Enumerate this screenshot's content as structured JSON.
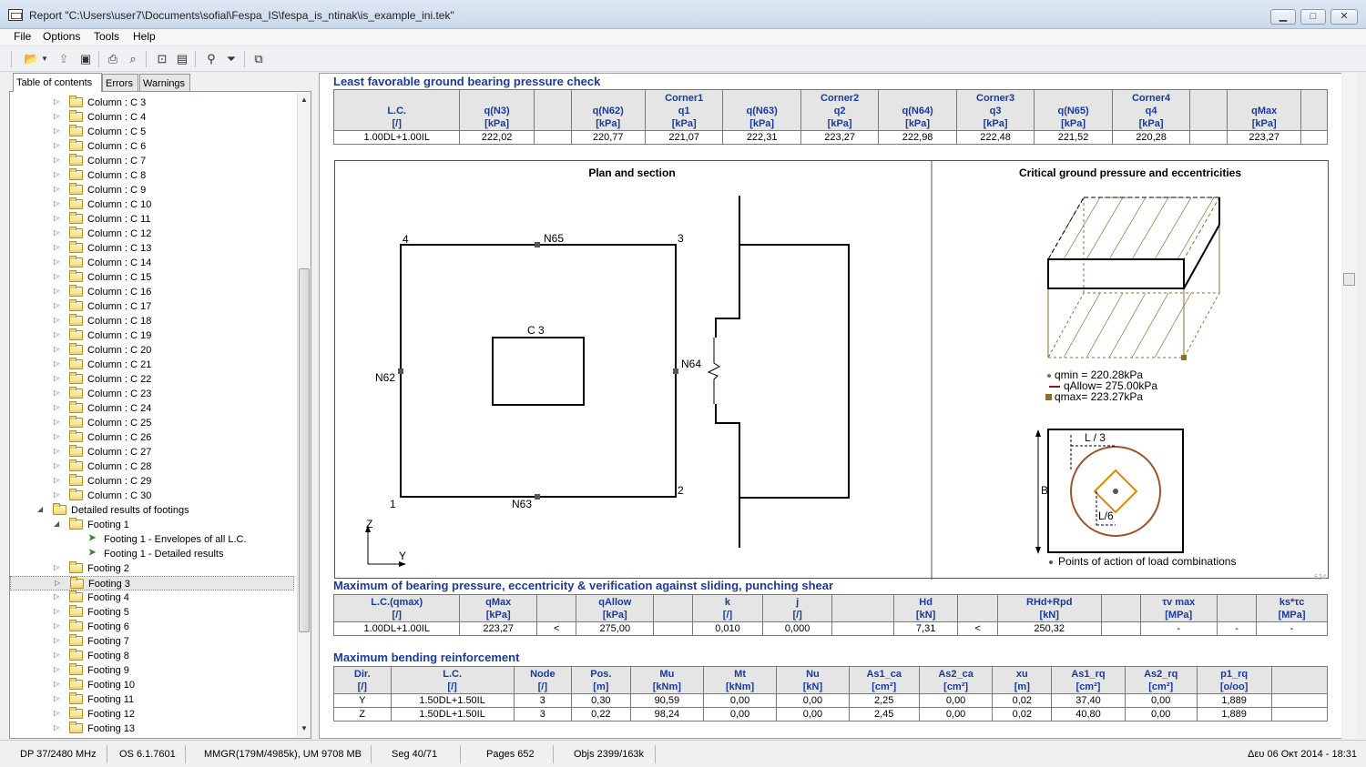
{
  "window": {
    "title": "Report \"C:\\Users\\user7\\Documents\\sofial\\Fespa_IS\\fespa_is_ntinak\\is_example_ini.tek\"",
    "minimize": "▁",
    "maximize": "□",
    "close": "✕"
  },
  "menu": [
    "File",
    "Options",
    "Tools",
    "Help"
  ],
  "tabs": [
    "Table of contents",
    "Errors",
    "Warnings"
  ],
  "tree": [
    {
      "label": "Column : C 3",
      "level": 2,
      "kind": "folder"
    },
    {
      "label": "Column : C 4",
      "level": 2,
      "kind": "folder"
    },
    {
      "label": "Column : C 5",
      "level": 2,
      "kind": "folder"
    },
    {
      "label": "Column : C 6",
      "level": 2,
      "kind": "folder"
    },
    {
      "label": "Column : C 7",
      "level": 2,
      "kind": "folder"
    },
    {
      "label": "Column : C 8",
      "level": 2,
      "kind": "folder"
    },
    {
      "label": "Column : C 9",
      "level": 2,
      "kind": "folder"
    },
    {
      "label": "Column : C 10",
      "level": 2,
      "kind": "folder"
    },
    {
      "label": "Column : C 11",
      "level": 2,
      "kind": "folder"
    },
    {
      "label": "Column : C 12",
      "level": 2,
      "kind": "folder"
    },
    {
      "label": "Column : C 13",
      "level": 2,
      "kind": "folder"
    },
    {
      "label": "Column : C 14",
      "level": 2,
      "kind": "folder"
    },
    {
      "label": "Column : C 15",
      "level": 2,
      "kind": "folder"
    },
    {
      "label": "Column : C 16",
      "level": 2,
      "kind": "folder"
    },
    {
      "label": "Column : C 17",
      "level": 2,
      "kind": "folder"
    },
    {
      "label": "Column : C 18",
      "level": 2,
      "kind": "folder"
    },
    {
      "label": "Column : C 19",
      "level": 2,
      "kind": "folder"
    },
    {
      "label": "Column : C 20",
      "level": 2,
      "kind": "folder"
    },
    {
      "label": "Column : C 21",
      "level": 2,
      "kind": "folder"
    },
    {
      "label": "Column : C 22",
      "level": 2,
      "kind": "folder"
    },
    {
      "label": "Column : C 23",
      "level": 2,
      "kind": "folder"
    },
    {
      "label": "Column : C 24",
      "level": 2,
      "kind": "folder"
    },
    {
      "label": "Column : C 25",
      "level": 2,
      "kind": "folder"
    },
    {
      "label": "Column : C 26",
      "level": 2,
      "kind": "folder"
    },
    {
      "label": "Column : C 27",
      "level": 2,
      "kind": "folder"
    },
    {
      "label": "Column : C 28",
      "level": 2,
      "kind": "folder"
    },
    {
      "label": "Column : C 29",
      "level": 2,
      "kind": "folder"
    },
    {
      "label": "Column : C 30",
      "level": 2,
      "kind": "folder"
    },
    {
      "label": "Detailed results of footings",
      "level": 1,
      "kind": "folder",
      "expanded": true
    },
    {
      "label": "Footing 1",
      "level": 2,
      "kind": "folder",
      "expanded": true
    },
    {
      "label": "Footing 1 - Envelopes of all L.C.",
      "level": 3,
      "kind": "doc"
    },
    {
      "label": "Footing 1 - Detailed results",
      "level": 3,
      "kind": "doc"
    },
    {
      "label": "Footing 2",
      "level": 2,
      "kind": "folder"
    },
    {
      "label": "Footing 3",
      "level": 2,
      "kind": "folder",
      "selected": true
    },
    {
      "label": "Footing 4",
      "level": 2,
      "kind": "folder"
    },
    {
      "label": "Footing 5",
      "level": 2,
      "kind": "folder"
    },
    {
      "label": "Footing 6",
      "level": 2,
      "kind": "folder"
    },
    {
      "label": "Footing 7",
      "level": 2,
      "kind": "folder"
    },
    {
      "label": "Footing 8",
      "level": 2,
      "kind": "folder"
    },
    {
      "label": "Footing 9",
      "level": 2,
      "kind": "folder"
    },
    {
      "label": "Footing 10",
      "level": 2,
      "kind": "folder"
    },
    {
      "label": "Footing 11",
      "level": 2,
      "kind": "folder"
    },
    {
      "label": "Footing 12",
      "level": 2,
      "kind": "folder"
    },
    {
      "label": "Footing 13",
      "level": 2,
      "kind": "folder"
    }
  ],
  "report": {
    "sec1": {
      "title": "Least favorable ground bearing pressure check",
      "headers": [
        [
          "",
          "L.C.",
          "[/]"
        ],
        [
          "",
          "q(N3)",
          "[kPa]"
        ],
        [
          "",
          "",
          ""
        ],
        [
          "",
          "q(N62)",
          "[kPa]"
        ],
        [
          "Corner1",
          "q1",
          "[kPa]"
        ],
        [
          "",
          "q(N63)",
          "[kPa]"
        ],
        [
          "Corner2",
          "q2",
          "[kPa]"
        ],
        [
          "",
          "q(N64)",
          "[kPa]"
        ],
        [
          "Corner3",
          "q3",
          "[kPa]"
        ],
        [
          "",
          "q(N65)",
          "[kPa]"
        ],
        [
          "Corner4",
          "q4",
          "[kPa]"
        ],
        [
          "",
          "",
          ""
        ],
        [
          "",
          "qMax",
          "[kPa]"
        ],
        [
          "",
          "",
          ""
        ]
      ],
      "row": [
        "1.00DL+1.00IL",
        "222,02",
        "",
        "220,77",
        "221,07",
        "222,31",
        "223,27",
        "222,98",
        "222,48",
        "221,52",
        "220,28",
        "",
        "223,27",
        ""
      ]
    },
    "plan": {
      "title": "Plan and section",
      "corner4": "4",
      "corner3": "3",
      "corner1": "1",
      "corner2": "2",
      "n65": "N65",
      "n62": "N62",
      "n63": "N63",
      "n64": "N64",
      "col": "C 3",
      "axz": "Z",
      "axy": "Y"
    },
    "pressure": {
      "title": "Critical ground pressure and eccentricities",
      "qmin": "qmin  = 220.28kPa",
      "qallow": "qAllow= 275.00kPa",
      "qmax": "qmax= 223.27kPa",
      "l3": "L / 3",
      "l6": "L/6",
      "b": "B",
      "points": "Points of action of load combinations",
      "pagenum": "634"
    },
    "sec2": {
      "title": "Maximum of bearing pressure, eccentricity & verification against sliding, punching shear",
      "headers": [
        [
          "L.C.(qmax)",
          "[/]"
        ],
        [
          "qMax",
          "[kPa]"
        ],
        [
          "",
          ""
        ],
        [
          "qAllow",
          "[kPa]"
        ],
        [
          "",
          ""
        ],
        [
          "k",
          "[/]"
        ],
        [
          "j",
          "[/]"
        ],
        [
          "",
          ""
        ],
        [
          "Hd",
          "[kN]"
        ],
        [
          "",
          ""
        ],
        [
          "RHd+Rpd",
          "[kN]"
        ],
        [
          "",
          ""
        ],
        [
          "τv max",
          "[MPa]"
        ],
        [
          "",
          ""
        ],
        [
          "ks*τc",
          "[MPa]"
        ]
      ],
      "row": [
        "1.00DL+1.00IL",
        "223,27",
        "<",
        "275,00",
        "",
        "0,010",
        "0,000",
        "",
        "7,31",
        "<",
        "250,32",
        "",
        "-",
        "-",
        "-"
      ]
    },
    "sec3": {
      "title": "Maximum bending reinforcement",
      "headers": [
        [
          "Dir.",
          "[/]"
        ],
        [
          "L.C.",
          "[/]"
        ],
        [
          "Node",
          "[/]"
        ],
        [
          "Pos.",
          "[m]"
        ],
        [
          "Mu",
          "[kNm]"
        ],
        [
          "Mt",
          "[kNm]"
        ],
        [
          "Nu",
          "[kN]"
        ],
        [
          "As1_ca",
          "[cm²]"
        ],
        [
          "As2_ca",
          "[cm²]"
        ],
        [
          "xu",
          "[m]"
        ],
        [
          "As1_rq",
          "[cm²]"
        ],
        [
          "As2_rq",
          "[cm²]"
        ],
        [
          "p1_rq",
          "[o/oo]"
        ],
        [
          "",
          ""
        ]
      ],
      "rows": [
        [
          "Y",
          "1.50DL+1.50IL",
          "3",
          "0,30",
          "90,59",
          "0,00",
          "0,00",
          "2,25",
          "0,00",
          "0,02",
          "37,40",
          "0,00",
          "1,889",
          ""
        ],
        [
          "Z",
          "1.50DL+1.50IL",
          "3",
          "0,22",
          "98,24",
          "0,00",
          "0,00",
          "2,45",
          "0,00",
          "0,02",
          "40,80",
          "0,00",
          "1,889",
          ""
        ]
      ]
    }
  },
  "status": [
    "DP 37/2480 MHz",
    "OS 6.1.7601",
    "MMGR(179M/4985k), UM 9708 MB",
    "Seg 40/71",
    "Pages 652",
    "Objs 2399/163k",
    "Δευ 06 Οκτ 2014 - 18:31"
  ],
  "colors": {
    "heading": "#1a3a9c",
    "hatch": "#8b6f2e",
    "qallow": "#8b1a1a",
    "circle": "#a0522d",
    "diamond": "#e08a00"
  }
}
